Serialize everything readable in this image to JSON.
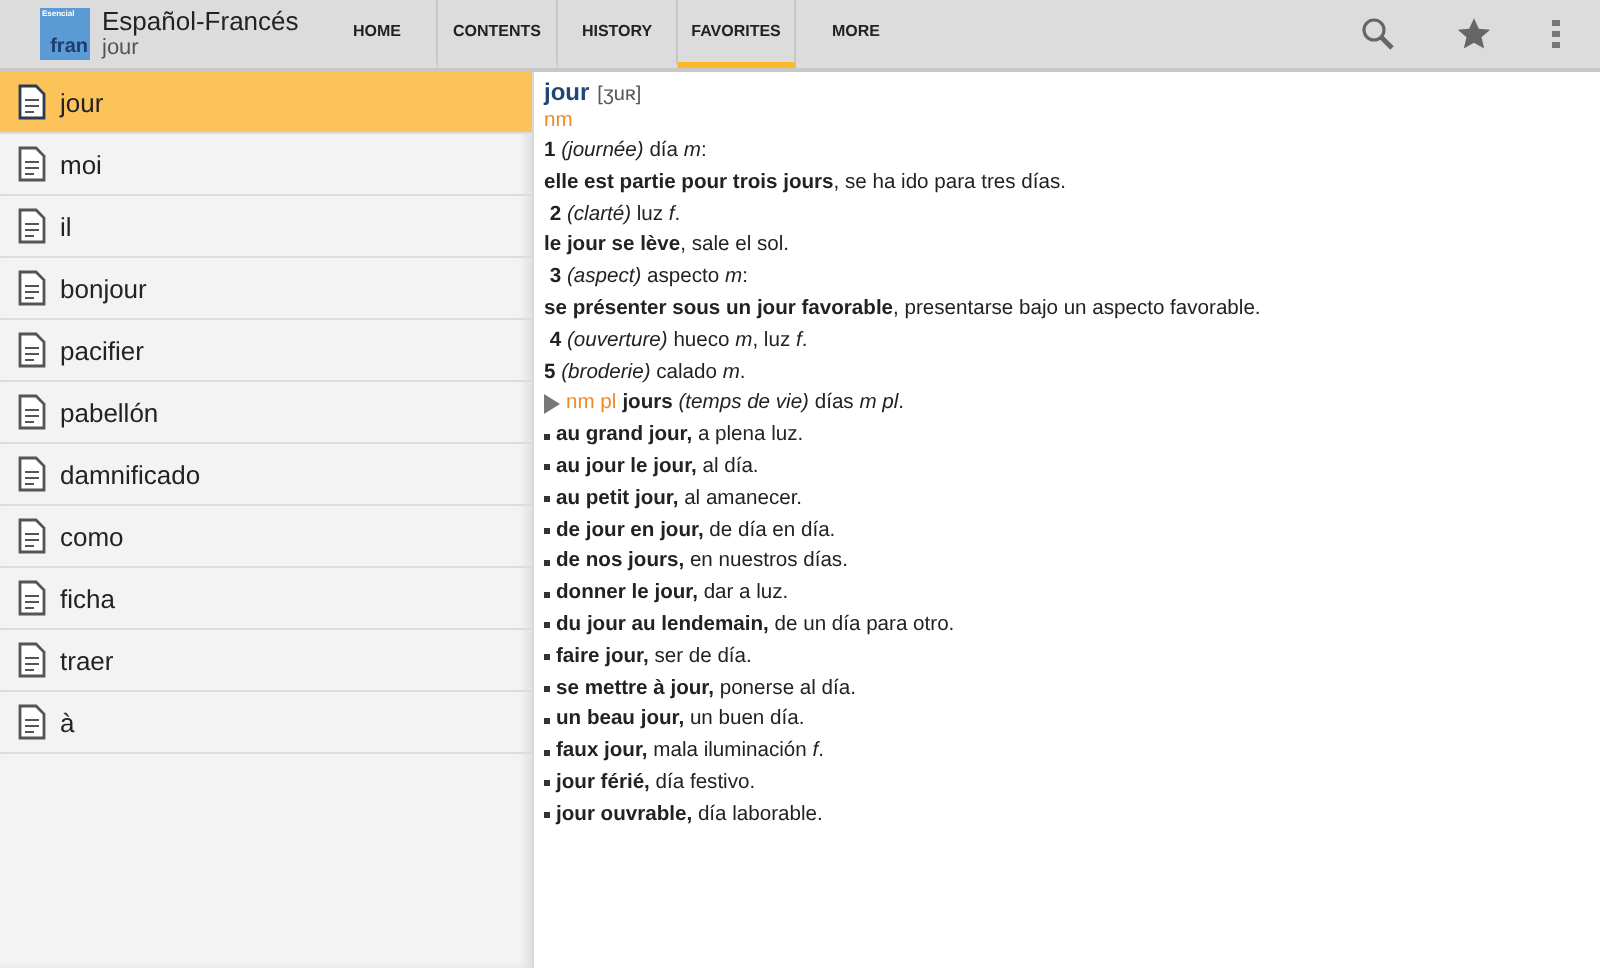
{
  "app_bar": {
    "logo": {
      "top": "Esencial",
      "bottom": "fran"
    },
    "title": "Español-Francés",
    "subtitle": "jour"
  },
  "tabs": [
    {
      "label": "HOME",
      "selected": false
    },
    {
      "label": "CONTENTS",
      "selected": false
    },
    {
      "label": "HISTORY",
      "selected": false
    },
    {
      "label": "FAVORITES",
      "selected": true
    },
    {
      "label": "MORE",
      "selected": false
    }
  ],
  "word_list": [
    {
      "label": "jour",
      "selected": true
    },
    {
      "label": "moi",
      "selected": false
    },
    {
      "label": "il",
      "selected": false
    },
    {
      "label": "bonjour",
      "selected": false
    },
    {
      "label": "pacifier",
      "selected": false
    },
    {
      "label": "pabellón",
      "selected": false
    },
    {
      "label": "damnificado",
      "selected": false
    },
    {
      "label": "como",
      "selected": false
    },
    {
      "label": "ficha",
      "selected": false
    },
    {
      "label": "traer",
      "selected": false
    },
    {
      "label": "à",
      "selected": false
    }
  ],
  "entry": {
    "headword": "jour",
    "pronunciation": "[ʒuʀ]",
    "pos": "nm",
    "lines": [
      {
        "kind": "sense",
        "text": "**1** *(journée)* día *m*:"
      },
      {
        "kind": "example",
        "text": "**elle est partie pour trois jours**, se ha ido para tres días."
      },
      {
        "kind": "sense",
        "text": " **2** *(clarté)* luz *f*."
      },
      {
        "kind": "example",
        "text": "**le jour se lève**, sale el sol."
      },
      {
        "kind": "sense",
        "text": " **3** *(aspect)* aspecto *m*:"
      },
      {
        "kind": "example",
        "text": "**se présenter sous un jour favorable**, presentarse bajo un aspecto favorable."
      },
      {
        "kind": "sense",
        "text": " **4** *(ouverture)* hueco *m*, luz *f*."
      },
      {
        "kind": "sense",
        "text": "**5** *(broderie)* calado *m*."
      },
      {
        "kind": "subentry",
        "pos": "nm pl",
        "text": "**jours** *(temps de vie)* días *m pl*."
      },
      {
        "kind": "bullet",
        "text": "**au grand jour,** a plena luz."
      },
      {
        "kind": "bullet",
        "text": "**au jour le jour,** al día."
      },
      {
        "kind": "bullet",
        "text": "**au petit jour,** al amanecer."
      },
      {
        "kind": "bullet",
        "text": "**de jour en jour,** de día en día."
      },
      {
        "kind": "bullet",
        "text": "**de nos jours,** en nuestros días."
      },
      {
        "kind": "bullet",
        "text": "**donner le jour,** dar a luz."
      },
      {
        "kind": "bullet",
        "text": "**du jour au lendemain,** de un día para otro."
      },
      {
        "kind": "bullet",
        "text": "**faire jour,** ser de día."
      },
      {
        "kind": "bullet",
        "text": "**se mettre à jour,** ponerse al día."
      },
      {
        "kind": "bullet",
        "text": "**un beau jour,** un buen día."
      },
      {
        "kind": "bullet",
        "text": "**faux jour,** mala iluminación *f*."
      },
      {
        "kind": "bullet",
        "text": "**jour férié,** día festivo."
      },
      {
        "kind": "bullet",
        "text": "**jour ouvrable,** día laborable."
      }
    ]
  }
}
